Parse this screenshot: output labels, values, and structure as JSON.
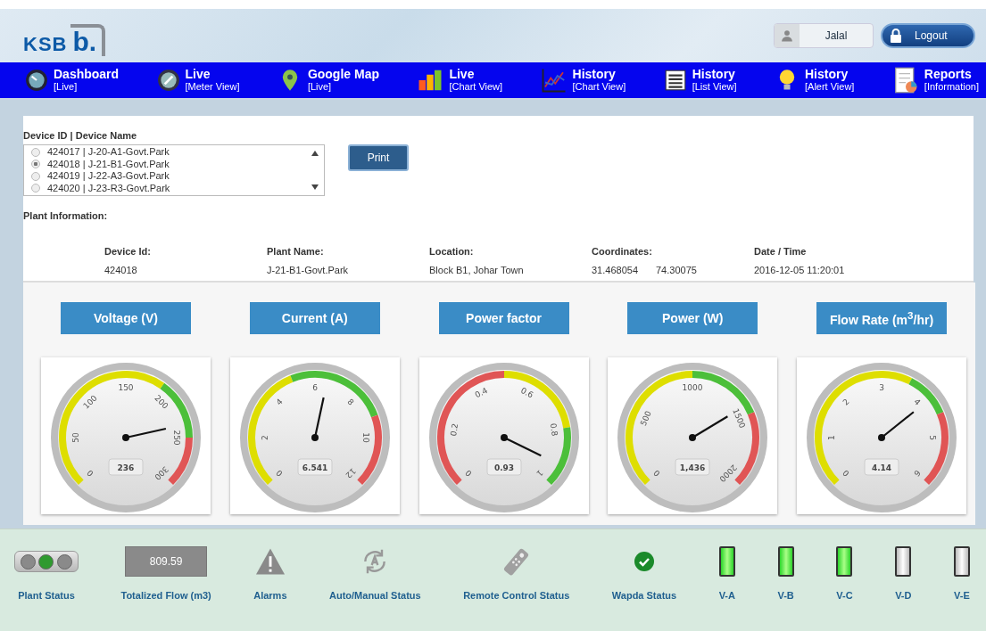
{
  "header": {
    "logo_text": "KSB",
    "logo_mark": "b.",
    "user": "Jalal",
    "logout": "Logout"
  },
  "nav": [
    {
      "title": "Dashboard",
      "subtitle": "[Live]"
    },
    {
      "title": "Live",
      "subtitle": "[Meter View]"
    },
    {
      "title": "Google Map",
      "subtitle": "[Live]"
    },
    {
      "title": "Live",
      "subtitle": "[Chart View]"
    },
    {
      "title": "History",
      "subtitle": "[Chart View]"
    },
    {
      "title": "History",
      "subtitle": "[List View]"
    },
    {
      "title": "History",
      "subtitle": "[Alert View]"
    },
    {
      "title": "Reports",
      "subtitle": "[Information]"
    }
  ],
  "device_select": {
    "label": "Device ID | Device Name",
    "options": [
      {
        "text": "424017 | J-20-A1-Govt.Park",
        "selected": false
      },
      {
        "text": "424018 | J-21-B1-Govt.Park",
        "selected": true
      },
      {
        "text": "424019 | J-22-A3-Govt.Park",
        "selected": false
      },
      {
        "text": "424020 | J-23-R3-Govt.Park",
        "selected": false
      }
    ]
  },
  "print_button": "Print",
  "plant_info": {
    "heading": "Plant Information:",
    "fields": [
      {
        "label": "Device Id:",
        "values": [
          "424018"
        ]
      },
      {
        "label": "Plant Name:",
        "values": [
          "J-21-B1-Govt.Park"
        ]
      },
      {
        "label": "Location:",
        "values": [
          "Block B1, Johar Town"
        ]
      },
      {
        "label": "Coordinates:",
        "values": [
          "31.468054",
          "74.30075"
        ]
      },
      {
        "label": "Date / Time",
        "values": [
          "2016-12-05 11:20:01"
        ]
      }
    ]
  },
  "gauges": [
    {
      "title": "Voltage (V)",
      "value": "236",
      "ticks": [
        "0",
        "50",
        "100",
        "150",
        "200",
        "250",
        "300"
      ],
      "bands": [
        {
          "color": "#dede00"
        },
        {
          "color": "#4cbf3a"
        },
        {
          "color": "#e05555"
        }
      ]
    },
    {
      "title": "Current (A)",
      "value": "6.541",
      "ticks": [
        "0",
        "2",
        "4",
        "6",
        "8",
        "10",
        "12"
      ],
      "bands": [
        {
          "color": "#dede00"
        },
        {
          "color": "#4cbf3a"
        },
        {
          "color": "#e05555"
        }
      ]
    },
    {
      "title": "Power factor",
      "value": "0.93",
      "ticks": [
        "0",
        "0.2",
        "0.4",
        "0.6",
        "0.8",
        "1"
      ],
      "bands": [
        {
          "color": "#e05555"
        },
        {
          "color": "#dede00"
        },
        {
          "color": "#4cbf3a"
        }
      ]
    },
    {
      "title": "Power (W)",
      "value": "1,436",
      "ticks": [
        "0",
        "500",
        "1000",
        "1500",
        "2000"
      ],
      "bands": [
        {
          "color": "#dede00"
        },
        {
          "color": "#4cbf3a"
        },
        {
          "color": "#e05555"
        }
      ]
    },
    {
      "title": "Flow Rate (m$^{3}$/hr)",
      "value": "4.14",
      "ticks": [
        "0",
        "1",
        "2",
        "3",
        "4",
        "5",
        "6"
      ],
      "bands": [
        {
          "color": "#dede00"
        },
        {
          "color": "#4cbf3a"
        },
        {
          "color": "#e05555"
        }
      ]
    }
  ],
  "status": [
    {
      "kind": "lights",
      "label": "Plant Status",
      "lights": [
        {
          "on": false
        },
        {
          "on": true
        },
        {
          "on": false
        }
      ]
    },
    {
      "kind": "display",
      "label": "Totalized Flow (m3)",
      "value": "809.59"
    },
    {
      "kind": "alarm",
      "label": "Alarms",
      "on": false
    },
    {
      "kind": "mode",
      "label": "Auto/Manual Status",
      "on": false
    },
    {
      "kind": "remote",
      "label": "Remote Control Status",
      "on": false
    },
    {
      "kind": "check",
      "label": "Wapda Status",
      "on": true
    },
    {
      "kind": "valve",
      "label": "V-A",
      "on": true
    },
    {
      "kind": "valve",
      "label": "V-B",
      "on": true
    },
    {
      "kind": "valve",
      "label": "V-C",
      "on": true
    },
    {
      "kind": "valve",
      "label": "V-D",
      "on": false
    },
    {
      "kind": "valve",
      "label": "V-E",
      "on": false
    }
  ]
}
